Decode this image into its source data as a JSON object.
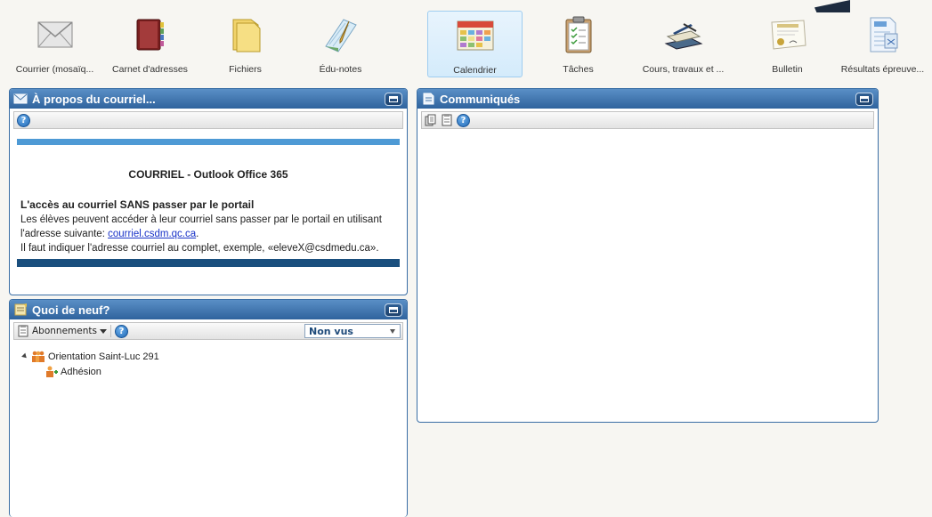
{
  "toolbar": {
    "items": [
      {
        "label": "Courrier (mosaïq...",
        "icon": "envelope-icon"
      },
      {
        "label": "Carnet d'adresses",
        "icon": "address-book-icon"
      },
      {
        "label": "Fichiers",
        "icon": "folder-icon"
      },
      {
        "label": "Édu-notes",
        "icon": "notepad-icon"
      },
      {
        "label": "Calendrier",
        "icon": "calendar-icon",
        "active": true
      },
      {
        "label": "Tâches",
        "icon": "clipboard-icon"
      },
      {
        "label": "Cours, travaux et ...",
        "icon": "books-icon"
      },
      {
        "label": "Bulletin",
        "icon": "certificate-icon"
      },
      {
        "label": "Résultats épreuve...",
        "icon": "test-results-icon"
      }
    ]
  },
  "about": {
    "title": "À propos du courriel...",
    "heading": "COURRIEL - Outlook Office 365",
    "subheading": "L'accès au courriel SANS passer par le portail",
    "line1": "Les élèves peuvent accéder à leur courriel sans passer par le portail en utilisant",
    "line2_prefix": "l'adresse suivante: ",
    "link": "courriel.csdm.qc.ca",
    "line2_suffix": ".",
    "line3": "Il faut indiquer l'adresse courriel au complet, exemple, «eleveX@csdmedu.ca»."
  },
  "news": {
    "title": "Quoi de neuf?",
    "subscriptions_label": "Abonnements",
    "filter_value": "Non vus",
    "group": "Orientation Saint-Luc 291",
    "child": "Adhésion"
  },
  "communiques": {
    "title": "Communiqués"
  },
  "colors": {
    "panel_header": "#2f639d",
    "accent_bar": "#4e9ad5",
    "dark_bar": "#1a4f7e",
    "link": "#1a33c8"
  }
}
